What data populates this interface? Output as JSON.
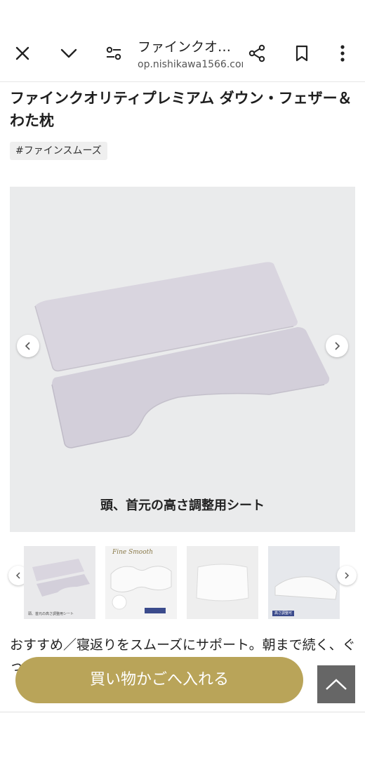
{
  "browser": {
    "page_title": "ファインクオ…",
    "url": "op.nishikawa1566.com",
    "icons": [
      "close-icon",
      "chevron-down-icon",
      "page-settings-icon",
      "share-icon",
      "bookmark-icon",
      "more-vert-icon"
    ]
  },
  "product": {
    "title": "ファインクオリティプレミアム ダウン・フェザー＆わた枕",
    "tag": "#ファインスムーズ"
  },
  "main_image": {
    "caption": "頭、首元の高さ調整用シート"
  },
  "thumbnails": [
    {
      "label": "頭、首元の高さ調整用シート",
      "badge": ""
    },
    {
      "label": "",
      "badge": "",
      "brand": "Fine Smooth"
    },
    {
      "label": "",
      "badge": ""
    },
    {
      "label": "",
      "badge": "高さ調整可"
    }
  ],
  "description": "おすすめ／寝返りをスムーズにサポート。朝まで続く、ぐっすりとした眠りとすっきりとした目覚めを",
  "actions": {
    "add_to_cart": "買い物かごへ入れる"
  },
  "colors": {
    "cta": "#b9a459",
    "scroll_top": "#666666",
    "pillow_sheet": "#d7d3de"
  }
}
